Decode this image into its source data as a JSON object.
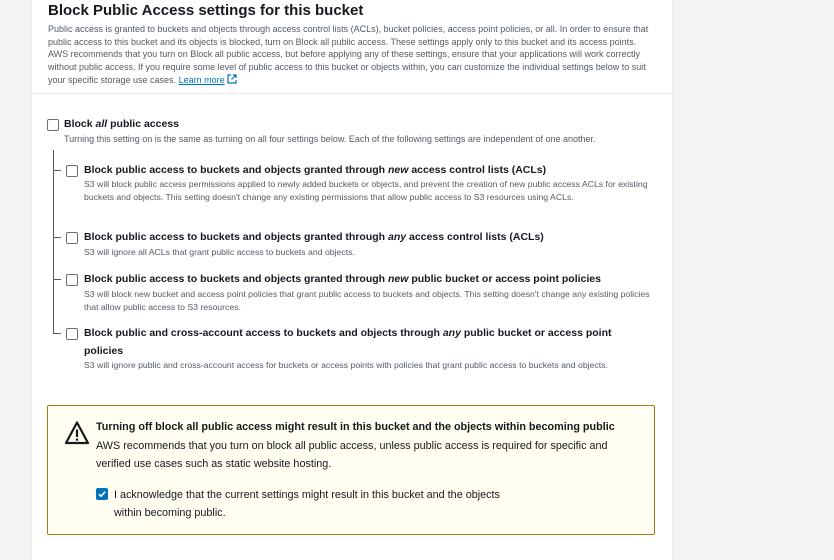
{
  "section": {
    "title": "Block Public Access settings for this bucket",
    "description": "Public access is granted to buckets and objects through access control lists (ACLs), bucket policies, access point policies, or all. In order to ensure that public access to this bucket and its objects is blocked, turn on Block all public access. These settings apply only to this bucket and its access points. AWS recommends that you turn on Block all public access, but before applying any of these settings, ensure that your applications will work correctly without public access. If you require some level of public access to this bucket or objects within, you can customize the individual settings below to suit your specific storage use cases.",
    "learn_more": "Learn more"
  },
  "block_all": {
    "label_pre": "Block ",
    "label_em": "all",
    "label_post": " public access",
    "help": "Turning this setting on is the same as turning on all four settings below. Each of the following settings are independent of one another.",
    "checked": false
  },
  "options": [
    {
      "label_pre": "Block public access to buckets and objects granted through ",
      "label_em": "new",
      "label_post": " access control lists (ACLs)",
      "help": "S3 will block public access permissions applied to newly added buckets or objects, and prevent the creation of new public access ACLs for existing buckets and objects. This setting doesn't change any existing permissions that allow public access to S3 resources using ACLs.",
      "checked": false
    },
    {
      "label_pre": "Block public access to buckets and objects granted through ",
      "label_em": "any",
      "label_post": " access control lists (ACLs)",
      "help": "S3 will ignore all ACLs that grant public access to buckets and objects.",
      "checked": false
    },
    {
      "label_pre": "Block public access to buckets and objects granted through ",
      "label_em": "new",
      "label_post": " public bucket or access point policies",
      "help": "S3 will block new bucket and access point policies that grant public access to buckets and objects. This setting doesn't change any existing policies that allow public access to S3 resources.",
      "checked": false
    },
    {
      "label_pre": "Block public and cross-account access to buckets and objects through ",
      "label_em": "any",
      "label_post": " public bucket or access point policies",
      "help": "S3 will ignore public and cross-account access for buckets or access points with policies that grant public access to buckets and objects.",
      "checked": false
    }
  ],
  "warning": {
    "icon": "warning-triangle-icon",
    "title": "Turning off block all public access might result in this bucket and the objects within becoming public",
    "body": "AWS recommends that you turn on block all public access, unless public access is required for specific and verified use cases such as static website hosting.",
    "ack_label": "I acknowledge that the current settings might result in this bucket and the objects within becoming public.",
    "ack_checked": true
  },
  "colors": {
    "link": "#0073bb",
    "checkbox_checked": "#0073bb",
    "warning_border": "#9e7b11",
    "warning_bg": "#fffef0"
  }
}
